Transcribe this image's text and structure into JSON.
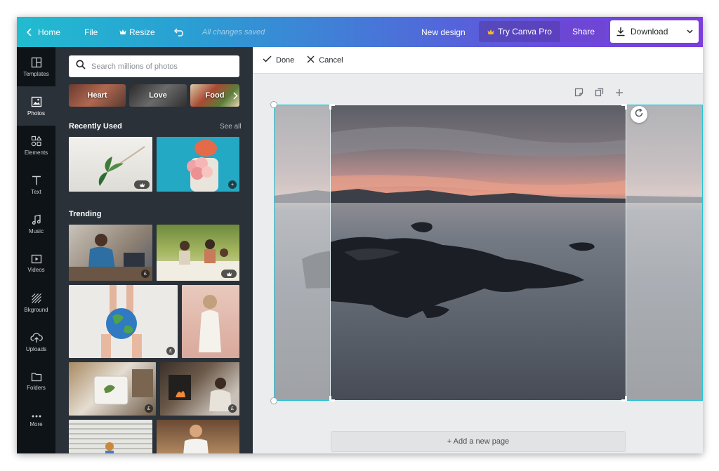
{
  "topbar": {
    "home_label": "Home",
    "file_label": "File",
    "resize_label": "Resize",
    "saved_status": "All changes saved",
    "new_design_label": "New design",
    "try_pro_label": "Try Canva Pro",
    "share_label": "Share",
    "download_label": "Download"
  },
  "rail": {
    "items": [
      {
        "label": "Templates",
        "icon": "templates-icon"
      },
      {
        "label": "Photos",
        "icon": "photos-icon"
      },
      {
        "label": "Elements",
        "icon": "elements-icon"
      },
      {
        "label": "Text",
        "icon": "text-icon"
      },
      {
        "label": "Music",
        "icon": "music-icon"
      },
      {
        "label": "Videos",
        "icon": "videos-icon"
      },
      {
        "label": "Bkground",
        "icon": "background-icon"
      },
      {
        "label": "Uploads",
        "icon": "uploads-icon"
      },
      {
        "label": "Folders",
        "icon": "folders-icon"
      },
      {
        "label": "More",
        "icon": "more-icon"
      }
    ],
    "active": "Photos"
  },
  "panel": {
    "search_placeholder": "Search millions of photos",
    "chips": [
      "Heart",
      "Love",
      "Food"
    ],
    "recently_used_title": "Recently Used",
    "see_all_label": "See all",
    "trending_title": "Trending",
    "badges": {
      "paid": "£"
    }
  },
  "editbar": {
    "done_label": "Done",
    "cancel_label": "Cancel"
  },
  "canvas": {
    "add_page_label": "+ Add a new page"
  },
  "colors": {
    "accent": "#27c3d3",
    "topbar_start": "#21bcd0",
    "topbar_end": "#7c3ddd",
    "sidebar": "#0e1318",
    "panel": "#2b3139"
  }
}
